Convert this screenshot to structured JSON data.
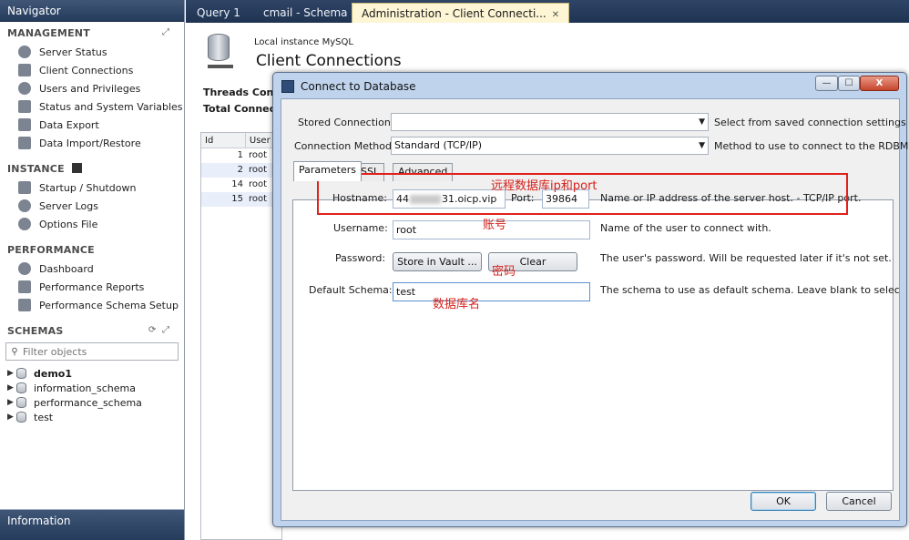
{
  "navigator": {
    "title": "Navigator",
    "management": {
      "title": "MANAGEMENT",
      "items": [
        "Server Status",
        "Client Connections",
        "Users and Privileges",
        "Status and System Variables",
        "Data Export",
        "Data Import/Restore"
      ]
    },
    "instance": {
      "title": "INSTANCE",
      "items": [
        "Startup / Shutdown",
        "Server Logs",
        "Options File"
      ]
    },
    "performance": {
      "title": "PERFORMANCE",
      "items": [
        "Dashboard",
        "Performance Reports",
        "Performance Schema Setup"
      ]
    },
    "schemas": {
      "title": "SCHEMAS",
      "filter_placeholder": "Filter objects",
      "items": [
        "demo1",
        "information_schema",
        "performance_schema",
        "test"
      ]
    },
    "information_title": "Information"
  },
  "tabs": [
    "Query 1",
    "cmail - Schema",
    "Administration - Client Connecti..."
  ],
  "main": {
    "subtitle": "Local instance MySQL",
    "title": "Client Connections",
    "threads_label": "Threads Conn",
    "total_label": "Total Connect",
    "grid": {
      "headers": [
        "Id",
        "User"
      ],
      "rows": [
        [
          "1",
          "root"
        ],
        [
          "2",
          "root"
        ],
        [
          "14",
          "root"
        ],
        [
          "15",
          "root"
        ]
      ]
    }
  },
  "dialog": {
    "title": "Connect to Database",
    "window_buttons": {
      "minimize": "—",
      "maximize": "☐",
      "close": "X"
    },
    "stored_connection": {
      "label": "Stored Connection:",
      "value": "",
      "desc": "Select from saved connection settings"
    },
    "connection_method": {
      "label": "Connection Method:",
      "value": "Standard (TCP/IP)",
      "desc": "Method to use to connect to the RDBMS"
    },
    "subtabs": [
      "Parameters",
      "SSL",
      "Advanced"
    ],
    "hostname": {
      "label": "Hostname:",
      "value_prefix": "44",
      "value_suffix": "31.oicp.vip",
      "desc": "Name or IP address of the server host. - TCP/IP port."
    },
    "port": {
      "label": "Port:",
      "value": "39864"
    },
    "username": {
      "label": "Username:",
      "value": "root",
      "desc": "Name of the user to connect with."
    },
    "password": {
      "label": "Password:",
      "store_button": "Store in Vault ...",
      "clear_button": "Clear",
      "desc": "The user's password. Will be requested later if it's not set."
    },
    "default_schema": {
      "label": "Default Schema:",
      "value": "test",
      "desc": "The schema to use as default schema. Leave blank to select it late"
    },
    "ok_button": "OK",
    "cancel_button": "Cancel"
  },
  "annotations": {
    "remote": "远程数据库ip和port",
    "account": "账号",
    "password": "密码",
    "dbname": "数据库名"
  },
  "colors": {
    "annotation": "#e0211c",
    "navigator_header": "#2f4566",
    "active_tab": "#fdf5d4"
  }
}
